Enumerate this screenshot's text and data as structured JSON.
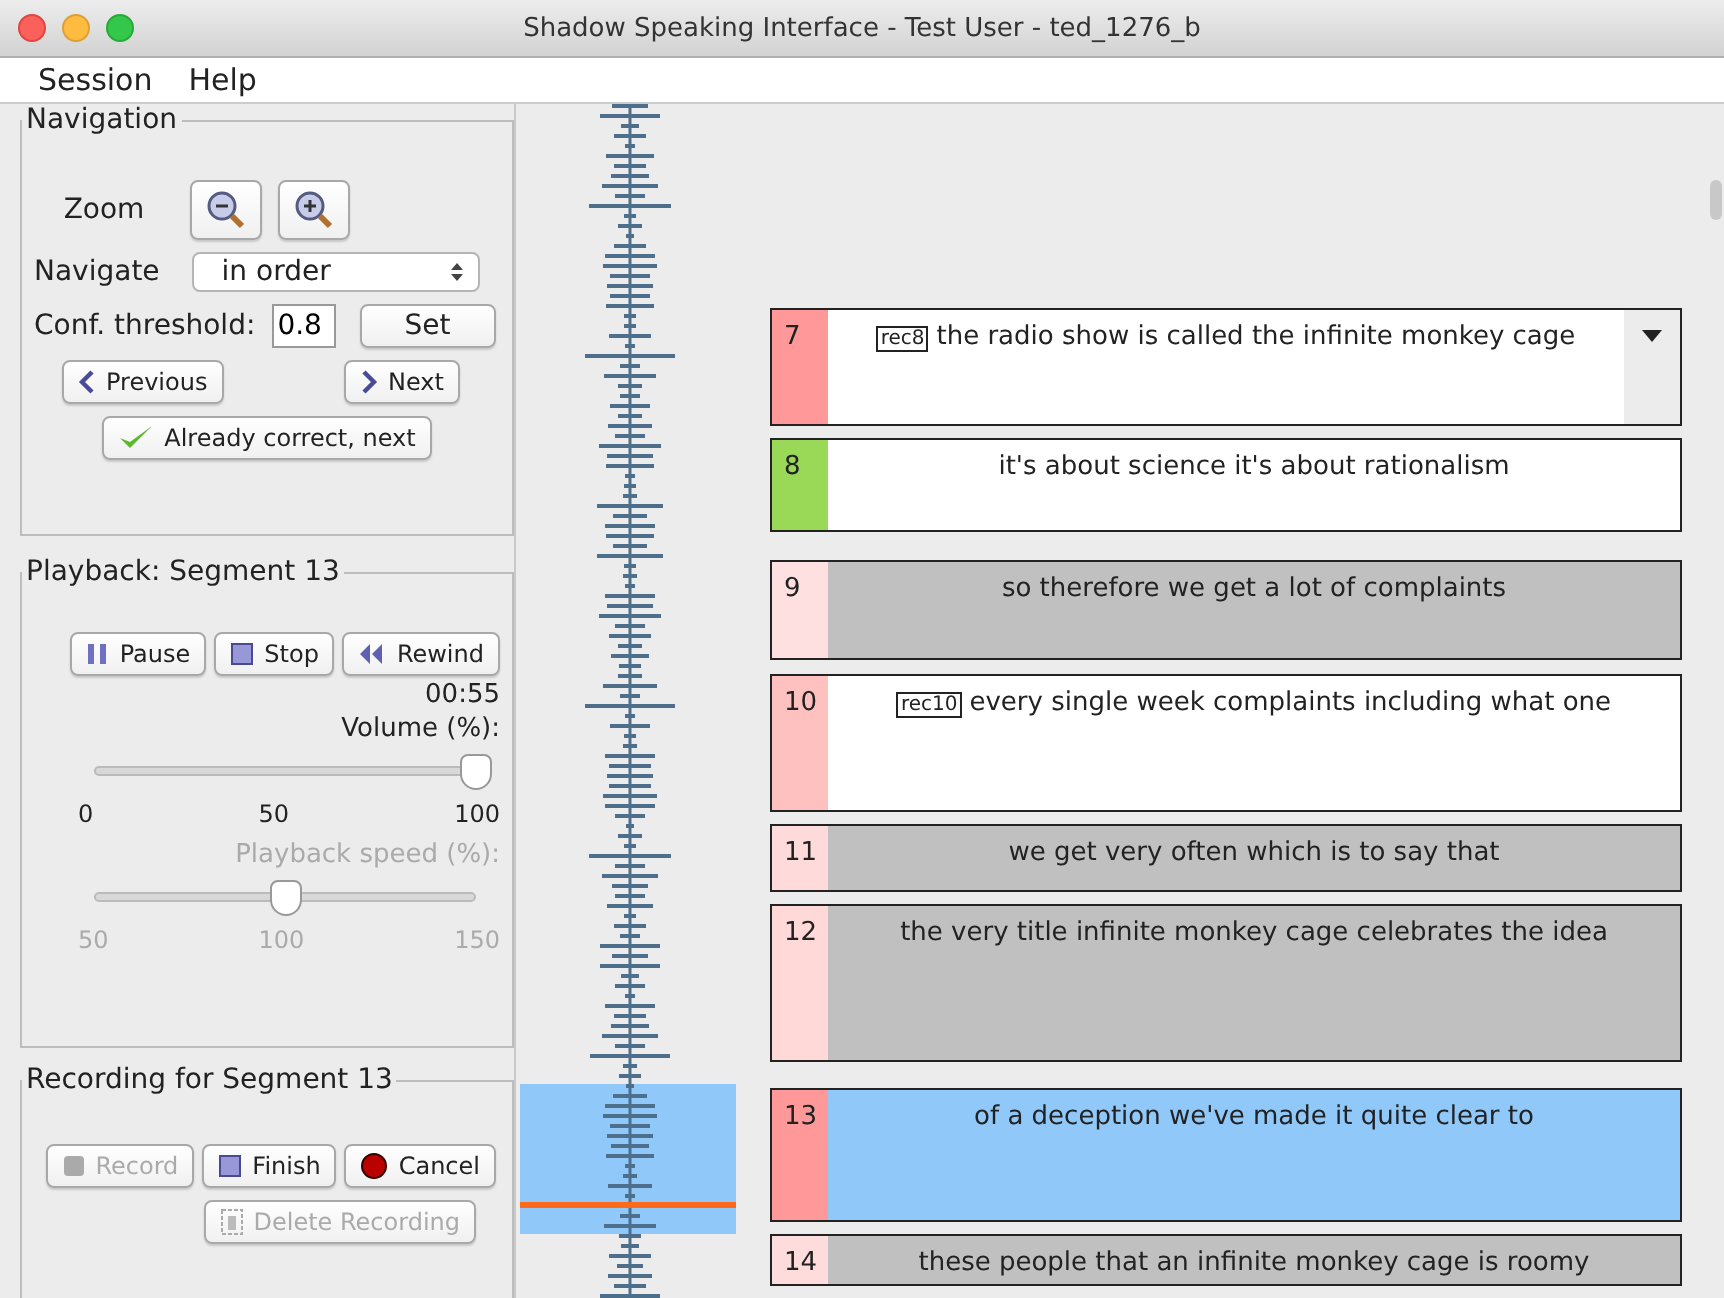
{
  "window": {
    "title": "Shadow Speaking Interface - Test User - ted_1276_b"
  },
  "menu": [
    "Session",
    "Help"
  ],
  "navigation": {
    "title": "Navigation",
    "zoom_label": "Zoom",
    "navigate_label": "Navigate",
    "navigate_value": "in order",
    "threshold_label": "Conf. threshold:",
    "threshold_value": "0.8",
    "set_button": "Set",
    "previous_button": "Previous",
    "next_button": "Next",
    "correct_button": "Already correct, next"
  },
  "playback": {
    "title": "Playback: Segment 13",
    "buttons": [
      {
        "label": "Pause",
        "kind": "pause"
      },
      {
        "label": "Stop",
        "kind": "stop"
      },
      {
        "label": "Rewind",
        "kind": "rewind"
      }
    ],
    "time": "00:55",
    "sliders": [
      {
        "label": "Volume (%):",
        "level": 1.0,
        "disabled": false,
        "ticks": [
          "0",
          "50",
          "100"
        ]
      },
      {
        "label": "Playback speed (%):",
        "level": 0.5,
        "disabled": true,
        "ticks": [
          "50",
          "100",
          "150"
        ]
      }
    ]
  },
  "recording": {
    "title": "Recording for Segment 13",
    "buttons": [
      {
        "label": "Record",
        "kind": "record",
        "disabled": true
      },
      {
        "label": "Finish",
        "kind": "finish",
        "disabled": false
      },
      {
        "label": "Cancel",
        "kind": "cancel",
        "disabled": false
      },
      {
        "label": "Delete Recording",
        "kind": "delete",
        "disabled": true
      }
    ]
  },
  "segments": [
    {
      "number": "7",
      "tag": "rec8",
      "text": "the radio show is called the infinite monkey cage",
      "color": "#ff9999",
      "greyed": false,
      "selected": false,
      "menu": true
    },
    {
      "number": "8",
      "text": "it's about science it's about rationalism",
      "color": "#99d957",
      "greyed": false,
      "selected": false,
      "menu": false
    },
    {
      "number": "9",
      "text": "so therefore we get a lot of complaints",
      "color": "#ffe0e0",
      "greyed": true,
      "selected": false,
      "menu": false
    },
    {
      "number": "10",
      "tag": "rec10",
      "text": "every single week complaints including what one",
      "color": "#ffc0c0",
      "greyed": false,
      "selected": false,
      "menu": false
    },
    {
      "number": "11",
      "text": "we get very often which is to say that",
      "color": "#ffdada",
      "greyed": true,
      "selected": false,
      "menu": false
    },
    {
      "number": "12",
      "text": "the very title infinite monkey cage celebrates the idea",
      "color": "#ffd8d8",
      "greyed": true,
      "selected": false,
      "menu": false
    },
    {
      "number": "13",
      "text": "of a deception we've made it quite clear to",
      "color": "#ff9999",
      "greyed": false,
      "selected": true,
      "menu": false
    },
    {
      "number": "14",
      "text": "these people that an infinite monkey cage is roomy",
      "color": "#ffdcdc",
      "greyed": true,
      "selected": false,
      "menu": false
    }
  ]
}
